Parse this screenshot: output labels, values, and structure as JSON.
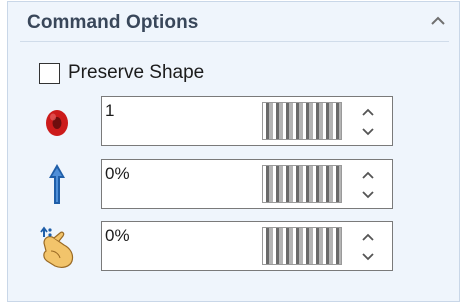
{
  "panel": {
    "title": "Command Options",
    "collapse_icon": "chevron-up-icon"
  },
  "preserve_shape": {
    "label": "Preserve Shape",
    "checked": false
  },
  "params": [
    {
      "icon": "ring-icon",
      "value": "1"
    },
    {
      "icon": "arrow-up-icon",
      "value": "0%"
    },
    {
      "icon": "hand-pinch-icon",
      "value": "0%"
    }
  ],
  "colors": {
    "panel_bg": "#eff5fc",
    "title": "#39475a",
    "ring": "#cc1b1b",
    "arrow": "#1f5ea8",
    "hand": "#f2c46b"
  }
}
